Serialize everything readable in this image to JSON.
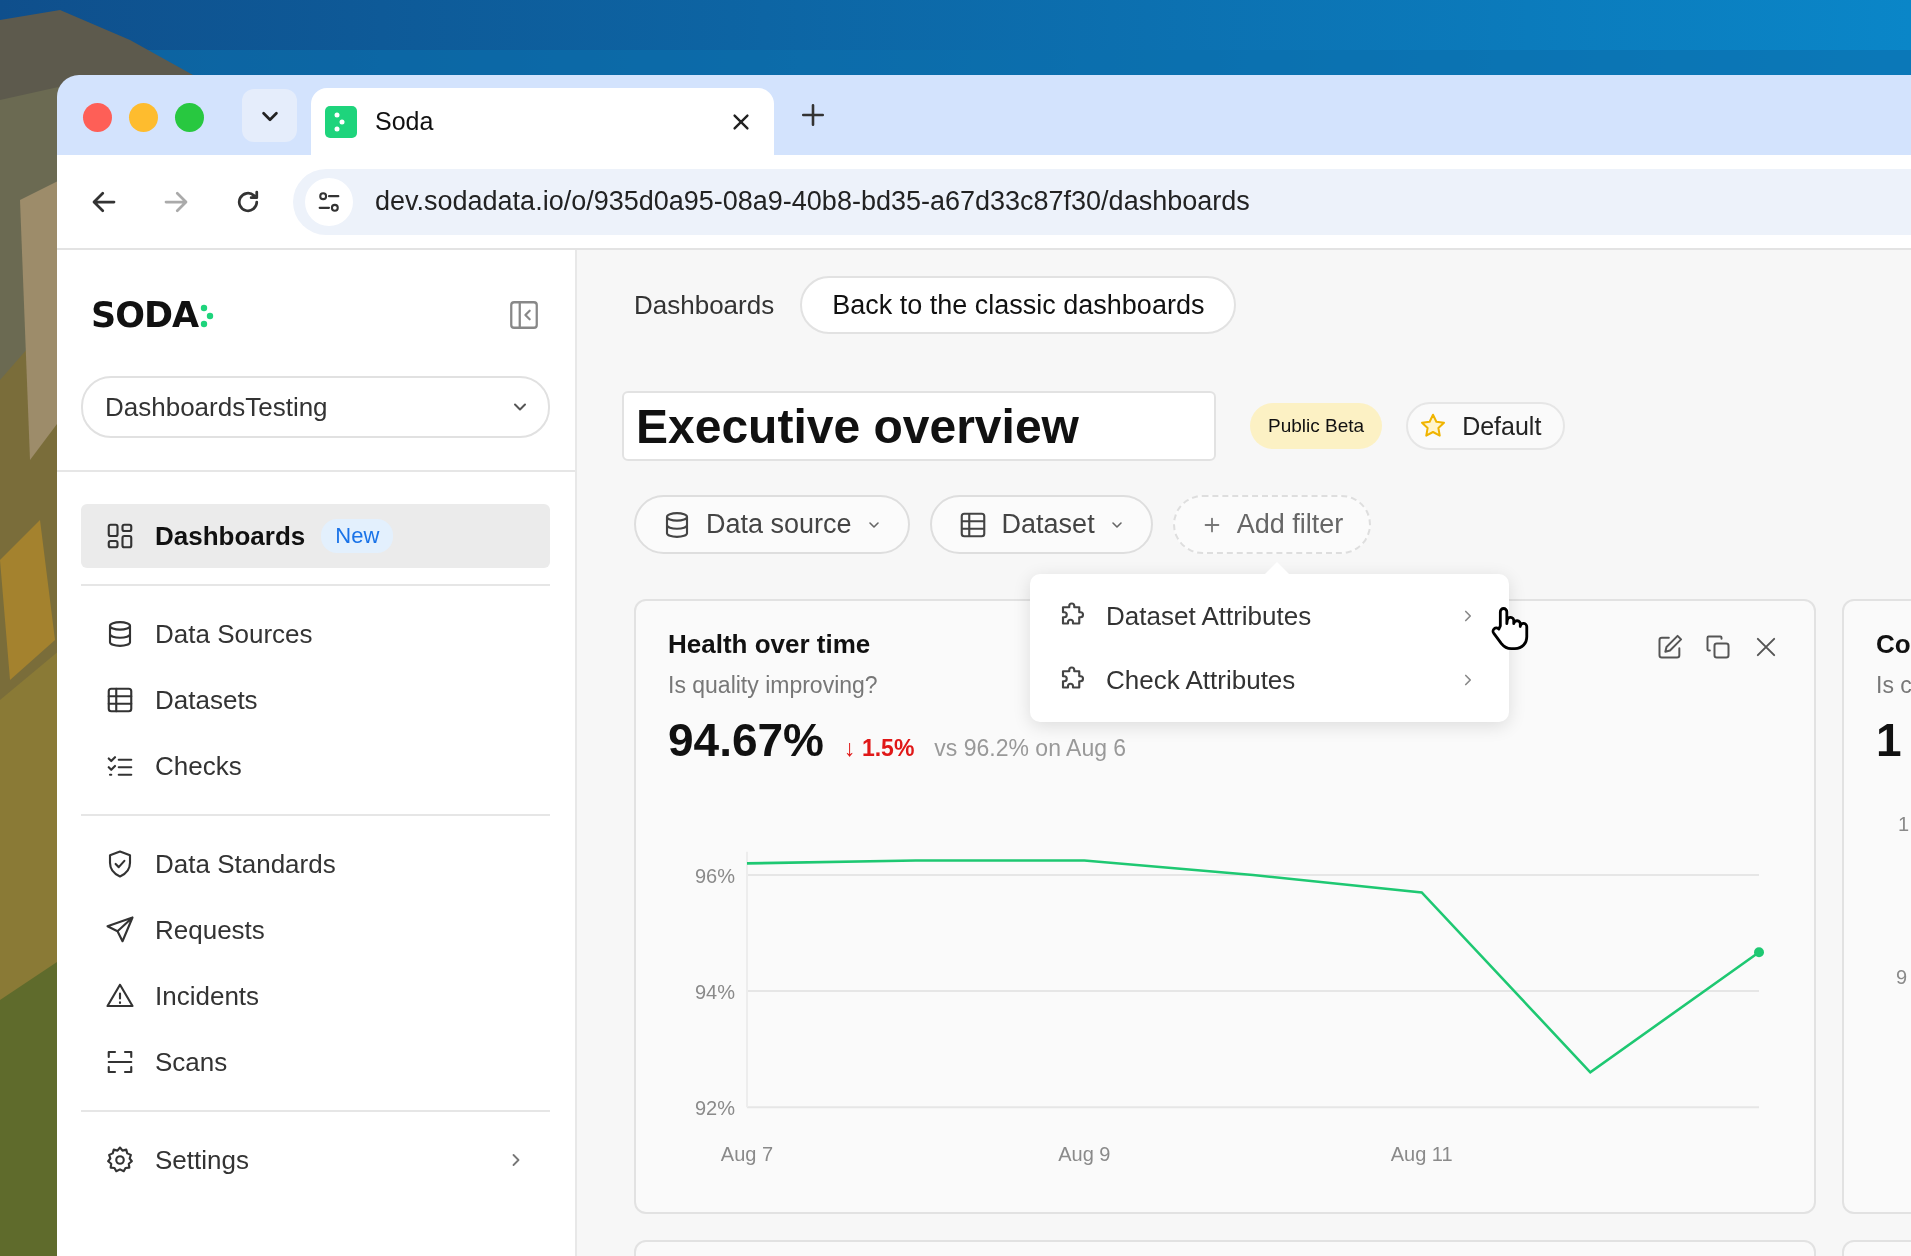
{
  "browser": {
    "tabs": [
      {
        "title": "Soda",
        "selected": true
      }
    ],
    "url": "dev.sodadata.io/o/935d0a95-08a9-40b8-bd35-a67d33c87f30/dashboards"
  },
  "sidebar": {
    "logo": "SODA",
    "workspace": "DashboardsTesting",
    "groups": [
      [
        {
          "label": "Dashboards",
          "kind": "link",
          "selected": true,
          "badge": "New"
        }
      ],
      [
        {
          "label": "Data Sources",
          "kind": "link",
          "selected": false
        },
        {
          "label": "Datasets",
          "kind": "link",
          "selected": false
        },
        {
          "label": "Checks",
          "kind": "link",
          "selected": false
        }
      ],
      [
        {
          "label": "Data Standards",
          "kind": "link",
          "selected": false
        },
        {
          "label": "Requests",
          "kind": "link",
          "selected": false
        },
        {
          "label": "Incidents",
          "kind": "link",
          "selected": false
        },
        {
          "label": "Scans",
          "kind": "link",
          "selected": false
        }
      ],
      [
        {
          "label": "Settings",
          "kind": "submenu",
          "selected": false
        }
      ]
    ]
  },
  "header": {
    "breadcrumb": "Dashboards",
    "back_button": "Back to the classic dashboards"
  },
  "dashboard": {
    "title": "Executive overview",
    "badge": "Public Beta",
    "default_button": "Default"
  },
  "filters": [
    {
      "label": "Data source",
      "kind": "select"
    },
    {
      "label": "Dataset",
      "kind": "select"
    },
    {
      "label": "Add filter",
      "kind": "add"
    }
  ],
  "filter_menu": [
    {
      "label": "Dataset Attributes"
    },
    {
      "label": "Check Attributes"
    }
  ],
  "card": {
    "title": "Health over time",
    "subtitle": "Is quality improving?",
    "value": "94.67%",
    "change": "↓ 1.5%",
    "comparison": "vs 96.2% on Aug 6",
    "chart_data": {
      "type": "line",
      "categories": [
        "Aug 7",
        null,
        "Aug 9",
        null,
        "Aug 11",
        null,
        null
      ],
      "series": [
        {
          "color": "#1ec872",
          "values": [
            96.2,
            96.25,
            96.25,
            96.0,
            95.7,
            92.6,
            94.67
          ]
        }
      ],
      "grid": true,
      "ylim": [
        92,
        96.4
      ],
      "yticks": [
        {
          "value": 92,
          "label": "92%"
        },
        {
          "value": 94,
          "label": "94%"
        },
        {
          "value": 96,
          "label": "96%"
        }
      ]
    }
  },
  "partial_card": {
    "title": "Co",
    "subtitle": "Is c",
    "value": "1",
    "axis_labels": [
      "1",
      "9"
    ]
  }
}
